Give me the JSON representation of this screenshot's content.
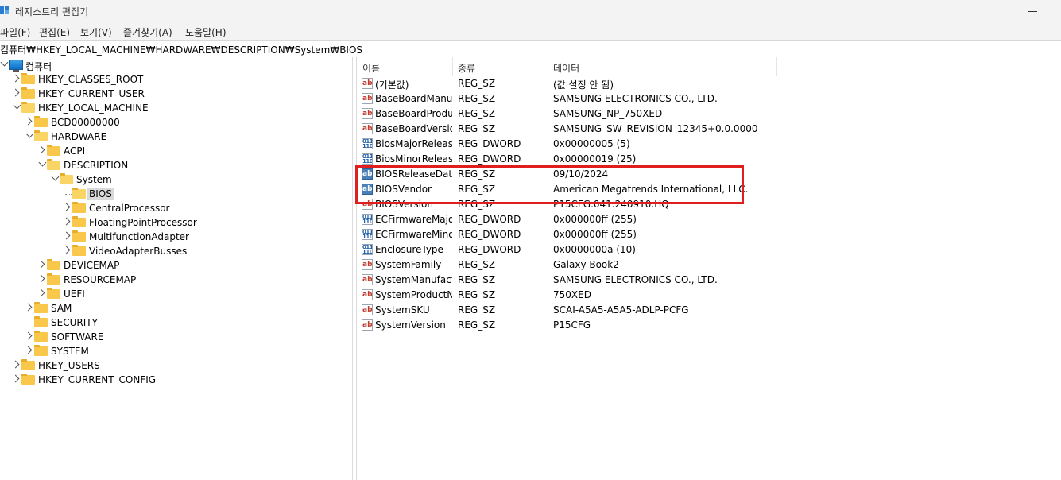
{
  "window": {
    "title": "레지스트리 편집기",
    "icons": {
      "app": "registry-editor-icon",
      "minimize": "minimize-icon"
    }
  },
  "menu": [
    "파일(F)",
    "편집(E)",
    "보기(V)",
    "즐겨찾기(A)",
    "도움말(H)"
  ],
  "address": "컴퓨터₩HKEY_LOCAL_MACHINE₩HARDWARE₩DESCRIPTION₩System₩BIOS",
  "tree": [
    {
      "label": "컴퓨터",
      "level": 0,
      "state": "open",
      "icon": "computer-icon"
    },
    {
      "label": "HKEY_CLASSES_ROOT",
      "level": 1,
      "state": "closed",
      "icon": "folder-icon"
    },
    {
      "label": "HKEY_CURRENT_USER",
      "level": 1,
      "state": "closed",
      "icon": "folder-icon"
    },
    {
      "label": "HKEY_LOCAL_MACHINE",
      "level": 1,
      "state": "open",
      "icon": "folder-open-icon"
    },
    {
      "label": "BCD00000000",
      "level": 2,
      "state": "closed",
      "icon": "folder-icon"
    },
    {
      "label": "HARDWARE",
      "level": 2,
      "state": "open",
      "icon": "folder-open-icon"
    },
    {
      "label": "ACPI",
      "level": 3,
      "state": "closed",
      "icon": "folder-icon"
    },
    {
      "label": "DESCRIPTION",
      "level": 3,
      "state": "open",
      "icon": "folder-open-icon"
    },
    {
      "label": "System",
      "level": 4,
      "state": "open",
      "icon": "folder-open-icon"
    },
    {
      "label": "BIOS",
      "level": 5,
      "state": "leaf",
      "icon": "folder-open-icon",
      "selected": true
    },
    {
      "label": "CentralProcessor",
      "level": 5,
      "state": "closed",
      "icon": "folder-icon"
    },
    {
      "label": "FloatingPointProcessor",
      "level": 5,
      "state": "closed",
      "icon": "folder-icon"
    },
    {
      "label": "MultifunctionAdapter",
      "level": 5,
      "state": "closed",
      "icon": "folder-icon"
    },
    {
      "label": "VideoAdapterBusses",
      "level": 5,
      "state": "closed",
      "icon": "folder-icon"
    },
    {
      "label": "DEVICEMAP",
      "level": 3,
      "state": "closed",
      "icon": "folder-icon"
    },
    {
      "label": "RESOURCEMAP",
      "level": 3,
      "state": "closed",
      "icon": "folder-icon"
    },
    {
      "label": "UEFI",
      "level": 3,
      "state": "closed",
      "icon": "folder-icon"
    },
    {
      "label": "SAM",
      "level": 2,
      "state": "closed",
      "icon": "folder-icon"
    },
    {
      "label": "SECURITY",
      "level": 2,
      "state": "leaf",
      "icon": "folder-icon"
    },
    {
      "label": "SOFTWARE",
      "level": 2,
      "state": "closed",
      "icon": "folder-icon"
    },
    {
      "label": "SYSTEM",
      "level": 2,
      "state": "closed",
      "icon": "folder-icon"
    },
    {
      "label": "HKEY_USERS",
      "level": 1,
      "state": "closed",
      "icon": "folder-icon"
    },
    {
      "label": "HKEY_CURRENT_CONFIG",
      "level": 1,
      "state": "closed",
      "icon": "folder-icon"
    }
  ],
  "columns": {
    "name": "이름",
    "type": "종류",
    "data": "데이터"
  },
  "values": [
    {
      "name": "(기본값)",
      "type": "REG_SZ",
      "data": "(값 설정 안 됨)",
      "kind": "sz"
    },
    {
      "name": "BaseBoardManufacturer",
      "type": "REG_SZ",
      "data": "SAMSUNG ELECTRONICS CO., LTD.",
      "kind": "sz"
    },
    {
      "name": "BaseBoardProduct",
      "type": "REG_SZ",
      "data": "SAMSUNG_NP_750XED",
      "kind": "sz"
    },
    {
      "name": "BaseBoardVersion",
      "type": "REG_SZ",
      "data": "SAMSUNG_SW_REVISION_12345+0.0.0000",
      "kind": "sz"
    },
    {
      "name": "BiosMajorRelease",
      "type": "REG_DWORD",
      "data": "0x00000005 (5)",
      "kind": "dword"
    },
    {
      "name": "BiosMinorRelease",
      "type": "REG_DWORD",
      "data": "0x00000019 (25)",
      "kind": "dword"
    },
    {
      "name": "BIOSReleaseDate",
      "type": "REG_SZ",
      "data": "09/10/2024",
      "kind": "sz",
      "highlighted": true
    },
    {
      "name": "BIOSVendor",
      "type": "REG_SZ",
      "data": "American Megatrends International, LLC.",
      "kind": "sz",
      "highlighted": true
    },
    {
      "name": "BIOSVersion",
      "type": "REG_SZ",
      "data": "P15CFG.041.240910.HQ",
      "kind": "sz"
    },
    {
      "name": "ECFirmwareMajorRelease",
      "type": "REG_DWORD",
      "data": "0x000000ff (255)",
      "kind": "dword"
    },
    {
      "name": "ECFirmwareMinorRelease",
      "type": "REG_DWORD",
      "data": "0x000000ff (255)",
      "kind": "dword"
    },
    {
      "name": "EnclosureType",
      "type": "REG_DWORD",
      "data": "0x0000000a (10)",
      "kind": "dword"
    },
    {
      "name": "SystemFamily",
      "type": "REG_SZ",
      "data": "Galaxy Book2",
      "kind": "sz"
    },
    {
      "name": "SystemManufacturer",
      "type": "REG_SZ",
      "data": "SAMSUNG ELECTRONICS CO., LTD.",
      "kind": "sz"
    },
    {
      "name": "SystemProductName",
      "type": "REG_SZ",
      "data": "750XED",
      "kind": "sz"
    },
    {
      "name": "SystemSKU",
      "type": "REG_SZ",
      "data": "SCAI-A5A5-A5A5-ADLP-PCFG",
      "kind": "sz"
    },
    {
      "name": "SystemVersion",
      "type": "REG_SZ",
      "data": "P15CFG",
      "kind": "sz"
    }
  ],
  "colors": {
    "highlight_box": "#e01e1e",
    "selection": "#d9d9d9",
    "folder": "#f9c74a"
  }
}
